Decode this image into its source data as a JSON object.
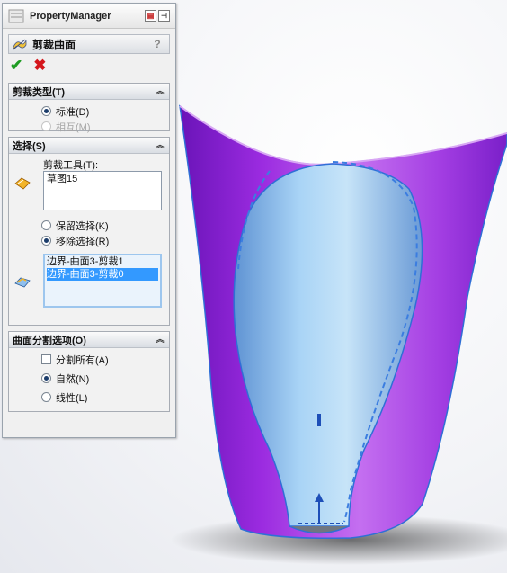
{
  "panel": {
    "title": "PropertyManager",
    "title_icons": [
      "pin-icon",
      "split-icon"
    ]
  },
  "feature": {
    "name": "剪裁曲面",
    "icon": "trim-surface-icon",
    "help_label": "?"
  },
  "actions": {
    "ok_glyph": "✔",
    "cancel_glyph": "✖"
  },
  "trim_type": {
    "header": "剪裁类型(T)",
    "collapse_glyph": "︽",
    "options": [
      {
        "label": "标准(D)",
        "selected": true,
        "enabled": true
      },
      {
        "label": "相互(M)",
        "selected": false,
        "enabled": false
      }
    ]
  },
  "selections": {
    "header": "选择(S)",
    "collapse_glyph": "︽",
    "trim_tool_label": "剪裁工具(T):",
    "trim_tool_items": [
      "草图15"
    ],
    "keep_remove": [
      {
        "label": "保留选择(K)",
        "selected": false
      },
      {
        "label": "移除选择(R)",
        "selected": true
      }
    ],
    "pieces": [
      {
        "label": "边界-曲面3-剪裁1",
        "selected": false
      },
      {
        "label": "边界-曲面3-剪裁0",
        "selected": true
      }
    ]
  },
  "split_options": {
    "header": "曲面分割选项(O)",
    "collapse_glyph": "︽",
    "split_all": {
      "label": "分割所有(A)",
      "checked": false
    },
    "modes": [
      {
        "label": "自然(N)",
        "selected": true
      },
      {
        "label": "线性(L)",
        "selected": false
      }
    ]
  },
  "colors": {
    "outer_surface": "#b04de6",
    "inner_surface": "#7fb8ee",
    "edge": "#2f6fd6",
    "annotation": "#e2161f",
    "ok": "#1f9c23",
    "cancel": "#d4161b"
  }
}
